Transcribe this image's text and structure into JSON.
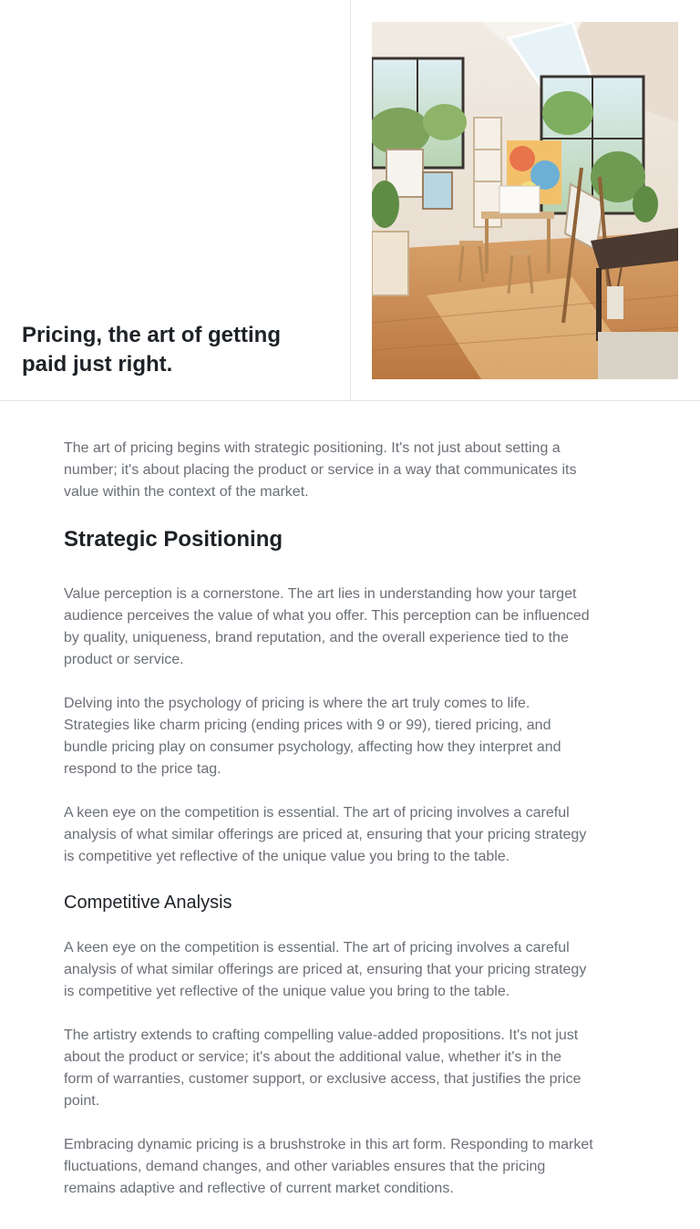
{
  "hero": {
    "title": "Pricing, the art of getting\npaid just right.",
    "image_subject": "sunlit-art-studio-photo"
  },
  "article": {
    "intro": "The art of pricing begins with strategic positioning. It's not just about setting a\nnumber; it's about placing the product or service in a way that communicates its\nvalue within the context of the market.",
    "section1_heading": "Strategic Positioning",
    "section1_p1": "Value perception is a cornerstone. The art lies in understanding how your target\naudience perceives the value of what you offer. This perception can be influenced\nby quality, uniqueness, brand reputation, and the overall experience tied to the\nproduct or service.",
    "section1_p2": "Delving into the psychology of pricing is where the art truly comes to life.\nStrategies like charm pricing (ending prices with 9 or 99), tiered pricing, and\nbundle pricing play on consumer psychology, affecting how they interpret and\nrespond to the price tag.",
    "section1_p3": "A keen eye on the competition is essential. The art of pricing involves a careful\nanalysis of what similar offerings are priced at, ensuring that your pricing strategy\nis competitive yet reflective of the unique value you bring to the table.",
    "section2_heading": "Competitive Analysis",
    "section2_p1": "A keen eye on the competition is essential. The art of pricing involves a careful\nanalysis of what similar offerings are priced at, ensuring that your pricing strategy\nis competitive yet reflective of the unique value you bring to the table.",
    "section2_p2": "The artistry extends to crafting compelling value-added propositions. It's not just\nabout the product or service; it's about the additional value, whether it's in the\nform of warranties, customer support, or exclusive access, that justifies the price\npoint.",
    "section2_p3": "Embracing dynamic pricing is a brushstroke in this art form. Responding to market\nfluctuations, demand changes, and other variables ensures that the pricing\nremains adaptive and reflective of current market conditions."
  }
}
